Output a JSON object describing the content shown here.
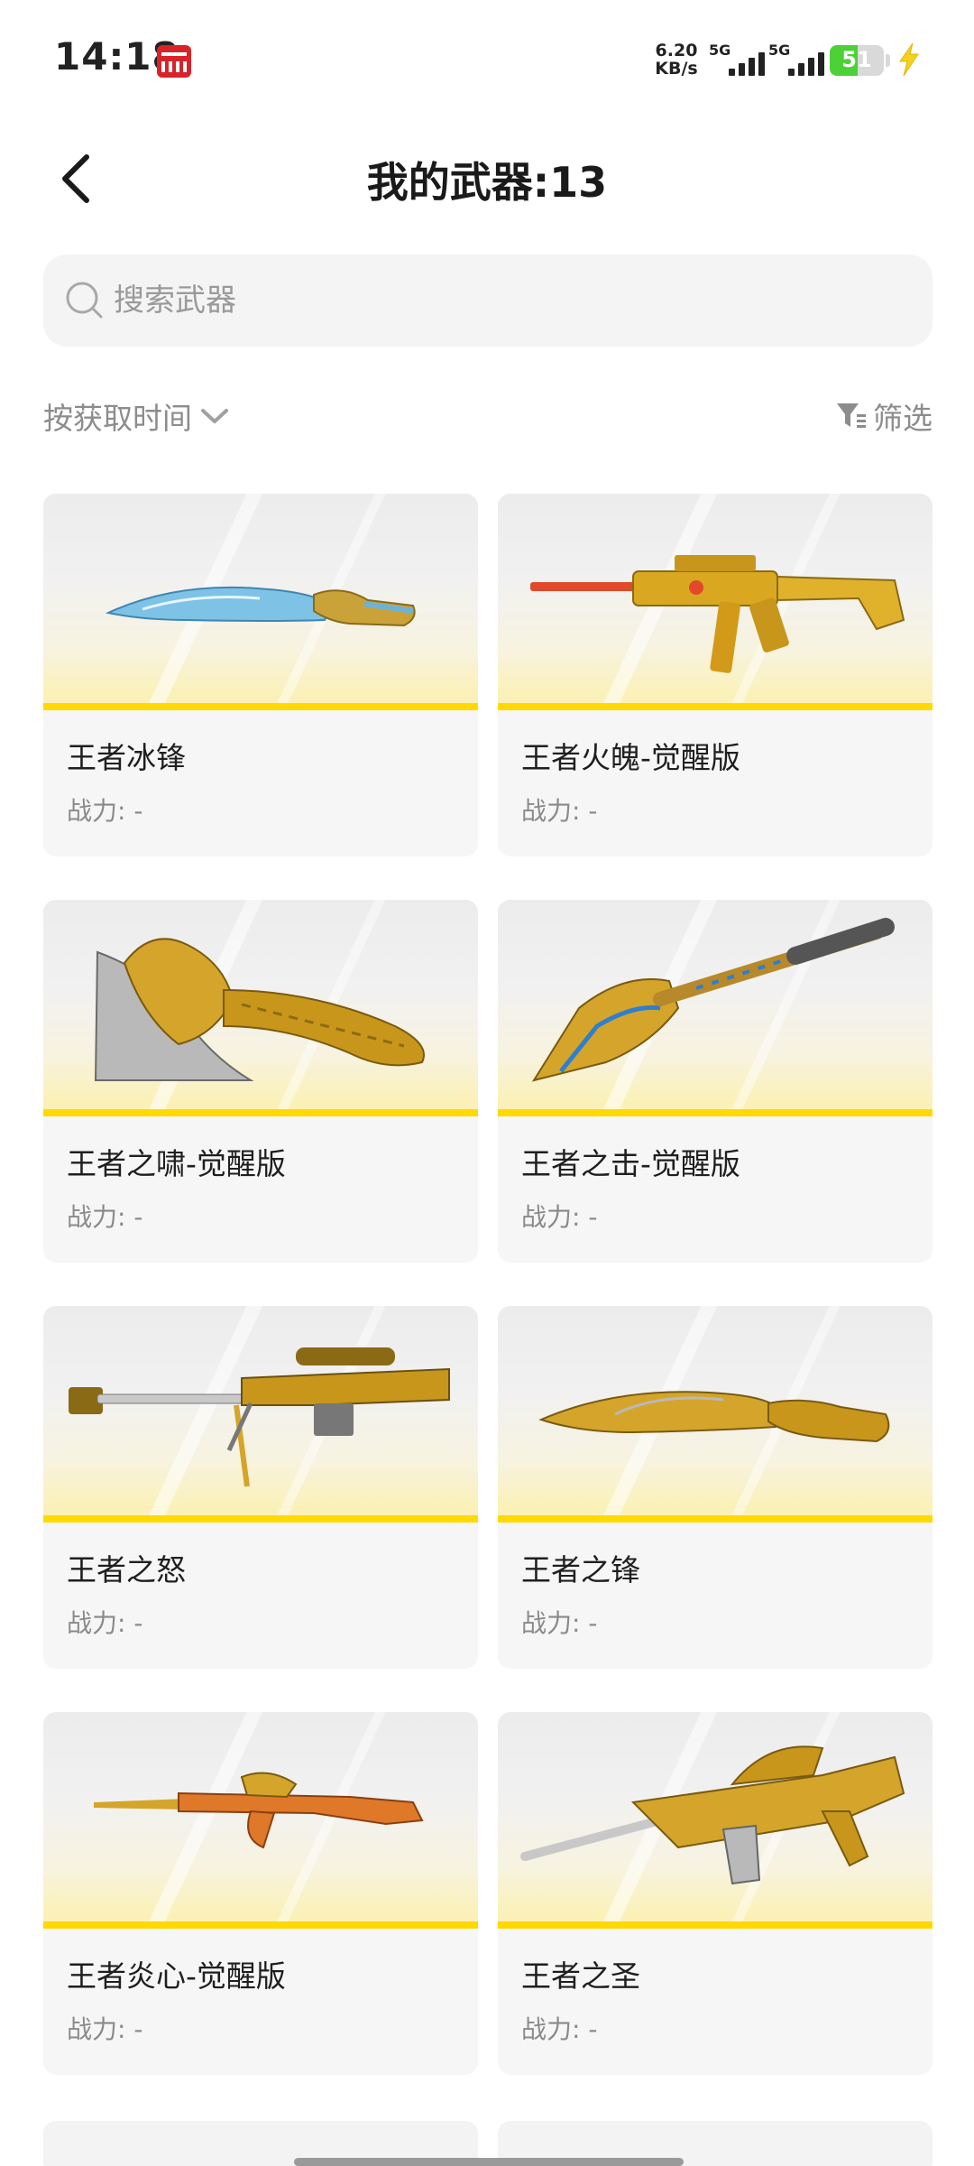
{
  "status_bar": {
    "time": "14:18",
    "net_speed_value": "6.20",
    "net_speed_unit": "KB/s",
    "sim1_label": "5G",
    "sim2_label": "5G",
    "battery_level": "51",
    "battery_fill_fraction": 0.51,
    "battery_color": "#4cd137"
  },
  "header": {
    "back_icon": "chevron-left-icon",
    "title": "我的武器:13"
  },
  "search": {
    "placeholder": "搜索武器",
    "value": ""
  },
  "toolbar": {
    "sort_label": "按获取时间",
    "filter_label": "筛选"
  },
  "accent_color": "#ffd900",
  "weapons": [
    {
      "name": "王者冰锋",
      "power": "战力: -"
    },
    {
      "name": "王者火魄-觉醒版",
      "power": "战力: -"
    },
    {
      "name": "王者之啸-觉醒版",
      "power": "战力: -"
    },
    {
      "name": "王者之击-觉醒版",
      "power": "战力: -"
    },
    {
      "name": "王者之怒",
      "power": "战力: -"
    },
    {
      "name": "王者之锋",
      "power": "战力: -"
    },
    {
      "name": "王者炎心-觉醒版",
      "power": "战力: -"
    },
    {
      "name": "王者之圣",
      "power": "战力: -"
    }
  ]
}
